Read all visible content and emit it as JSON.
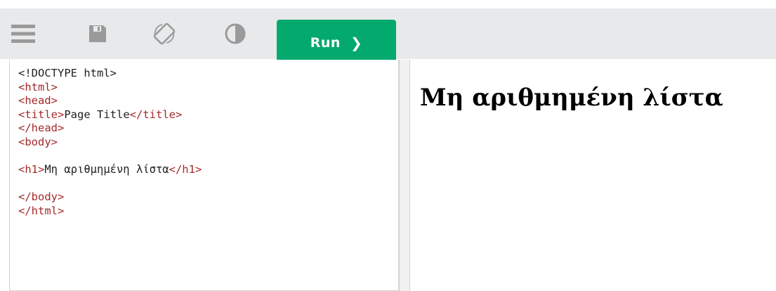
{
  "toolbar": {
    "icons": [
      "menu-icon",
      "save-icon",
      "rotate-icon",
      "contrast-icon"
    ],
    "run_label": "Run",
    "run_chevron": "❯",
    "background": "#e7e9eb",
    "run_color": "#04aa6d"
  },
  "editor": {
    "lines": [
      {
        "parts": [
          {
            "t": "<!DOCTYPE html>",
            "c": "plain"
          }
        ]
      },
      {
        "parts": [
          {
            "t": "<html>",
            "c": "tag"
          }
        ]
      },
      {
        "parts": [
          {
            "t": "<head>",
            "c": "tag"
          }
        ]
      },
      {
        "parts": [
          {
            "t": "<title>",
            "c": "tag"
          },
          {
            "t": "Page Title",
            "c": "plain"
          },
          {
            "t": "</title>",
            "c": "tag"
          }
        ]
      },
      {
        "parts": [
          {
            "t": "</head>",
            "c": "tag"
          }
        ]
      },
      {
        "parts": [
          {
            "t": "<body>",
            "c": "tag"
          }
        ]
      },
      {
        "parts": []
      },
      {
        "parts": [
          {
            "t": "<h1>",
            "c": "tag"
          },
          {
            "t": "Μη αριθμημένη λίστα",
            "c": "plain"
          },
          {
            "t": "</h1>",
            "c": "tag"
          }
        ]
      },
      {
        "parts": []
      },
      {
        "parts": [
          {
            "t": "</body>",
            "c": "tag"
          }
        ]
      },
      {
        "parts": [
          {
            "t": "</html>",
            "c": "tag"
          }
        ]
      }
    ]
  },
  "preview": {
    "heading": "Μη αριθμημένη λίστα"
  }
}
